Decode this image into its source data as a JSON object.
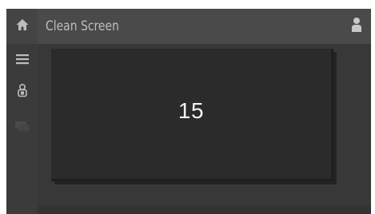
{
  "header": {
    "title": "Clean Screen"
  },
  "sidebar": {
    "items": [
      {
        "icon": "home-icon"
      },
      {
        "icon": "menu-icon"
      },
      {
        "icon": "tool-icon"
      },
      {
        "icon": "chat-icon"
      }
    ]
  },
  "header_right": {
    "icon": "user-icon"
  },
  "main": {
    "counter": "15"
  },
  "colors": {
    "background": "#343434",
    "header": "#4a4a4a",
    "panel": "#2b2b2b",
    "text": "#f2f2f2"
  }
}
